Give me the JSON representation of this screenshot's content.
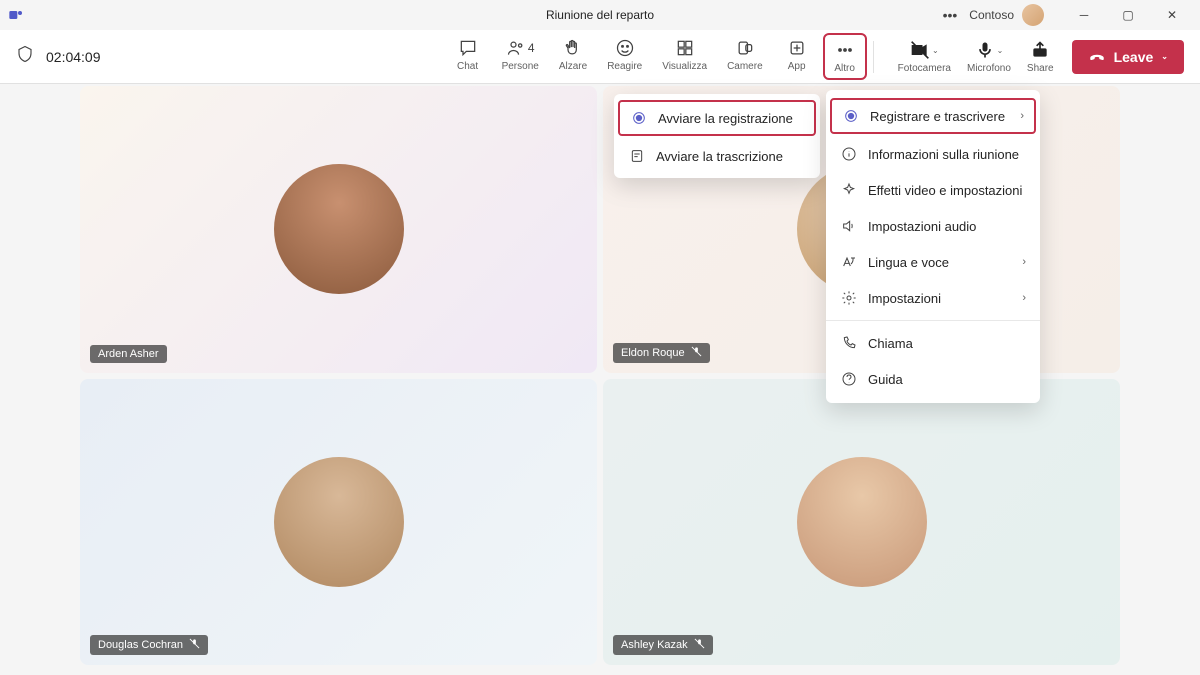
{
  "titlebar": {
    "meeting_title": "Riunione del reparto",
    "org_name": "Contoso"
  },
  "toolbar": {
    "duration": "02:04:09",
    "items": {
      "chat": "Chat",
      "people": "Persone",
      "people_count": "4",
      "raise": "Alzare",
      "react": "Reagire",
      "view": "Visualizza",
      "rooms": "Camere",
      "apps": "App",
      "more": "Altro"
    },
    "camera": "Fotocamera",
    "mic": "Microfono",
    "share": "Share",
    "leave": "Leave"
  },
  "participants": [
    {
      "name": "Arden Asher",
      "muted": false
    },
    {
      "name": "Eldon Roque",
      "muted": true
    },
    {
      "name": "Douglas Cochran",
      "muted": true
    },
    {
      "name": "Ashley Kazak",
      "muted": true
    }
  ],
  "submenu": {
    "start_recording": "Avviare la registrazione",
    "start_transcription": "Avviare la trascrizione"
  },
  "mainmenu": {
    "record_transcribe": "Registrare e trascrivere",
    "meeting_info": "Informazioni sulla riunione",
    "video_effects": "Effetti video e impostazioni",
    "audio_settings": "Impostazioni audio",
    "language_voice": "Lingua e voce",
    "settings": "Impostazioni",
    "call": "Chiama",
    "guide": "Guida"
  }
}
